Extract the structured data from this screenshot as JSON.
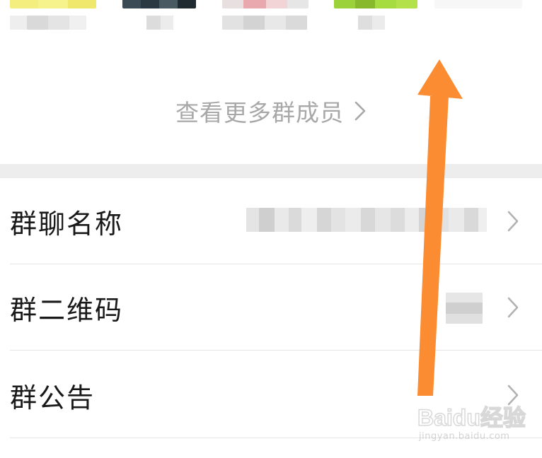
{
  "group_info": {
    "see_more_members": "查看更多群成员"
  },
  "settings": {
    "items": [
      {
        "label": "群聊名称"
      },
      {
        "label": "群二维码"
      },
      {
        "label": "群公告"
      }
    ]
  },
  "colors": {
    "arrow": "#fb8c32",
    "separator": "#ededed",
    "muted_text": "#a8a8a8"
  },
  "watermark": {
    "logo": "Baidu经验",
    "url": "jingyan.baidu.com"
  }
}
